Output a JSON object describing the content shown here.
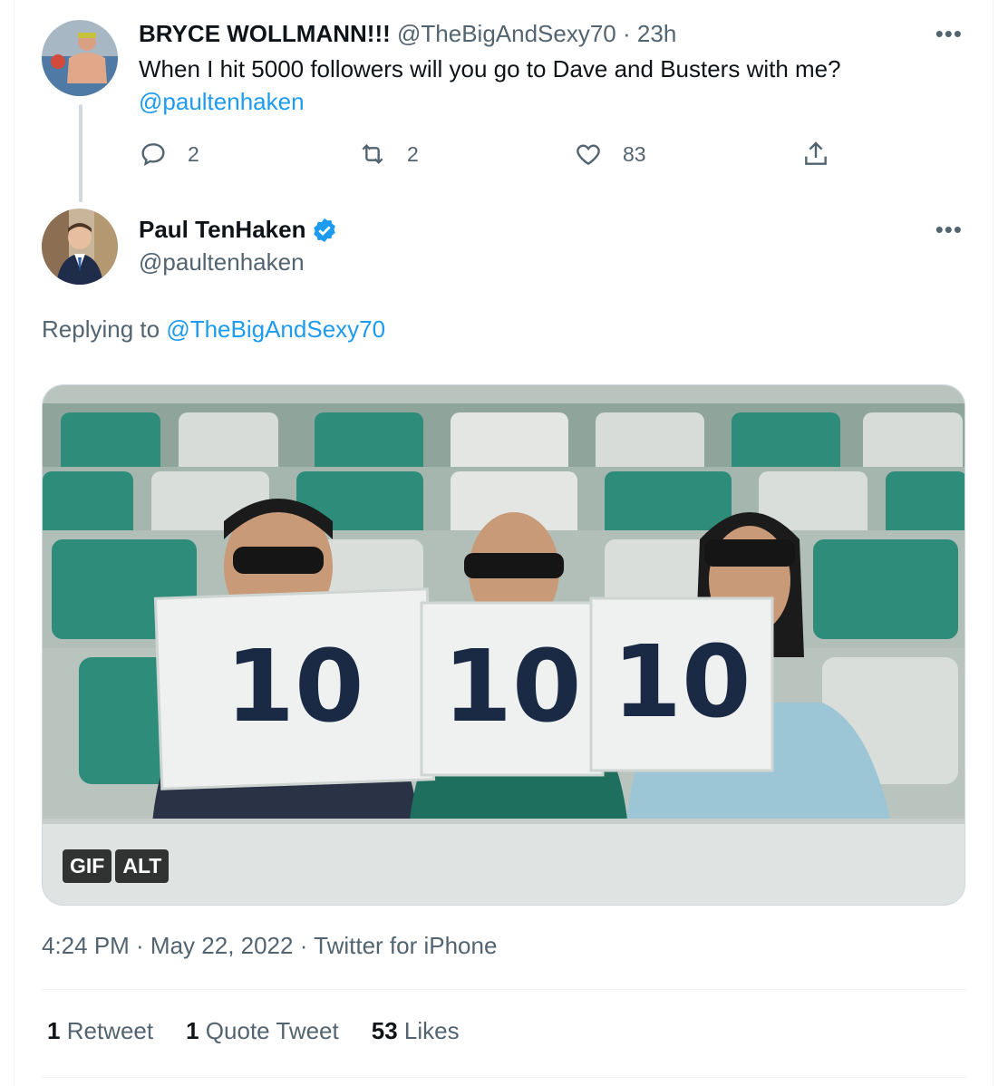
{
  "reply_to_tweet": {
    "author_name": "BRYCE WOLLMANN!!!",
    "author_handle": "@TheBigAndSexy70",
    "time": "23h",
    "text": "When I hit 5000 followers will you go to Dave and Busters with me?",
    "mention": "@paultenhaken",
    "reply_count": "2",
    "retweet_count": "2",
    "like_count": "83"
  },
  "main_tweet": {
    "author_name": "Paul TenHaken",
    "author_handle": "@paultenhaken",
    "replying_label": "Replying to",
    "replying_to": "@TheBigAndSexy70",
    "media_badges": [
      "GIF",
      "ALT"
    ],
    "sign_text": "10",
    "timestamp": "4:24 PM · May 22, 2022 · Twitter for iPhone",
    "stats": {
      "retweets_count": "1",
      "retweets_label": "Retweet",
      "quote_count": "1",
      "quote_label": "Quote Tweet",
      "likes_count": "53",
      "likes_label": "Likes"
    }
  },
  "colors": {
    "accent": "#1d9bf0",
    "secondary_text": "#536471",
    "verified": "#1d9bf0"
  }
}
